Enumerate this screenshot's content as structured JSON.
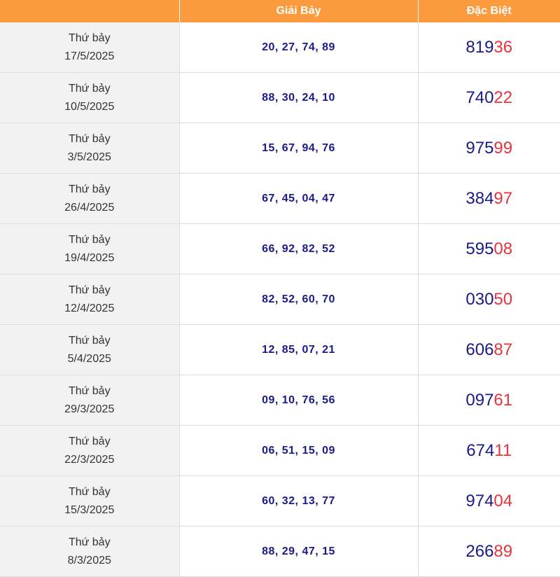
{
  "table": {
    "headers": {
      "date": "",
      "g7": "Giải Bảy",
      "db": "Đặc Biệt"
    },
    "rows": [
      {
        "day": "Thứ bảy",
        "date": "17/5/2025",
        "g7": "20, 27, 74, 89",
        "db_head": "819",
        "db_tail": "36"
      },
      {
        "day": "Thứ bảy",
        "date": "10/5/2025",
        "g7": "88, 30, 24, 10",
        "db_head": "740",
        "db_tail": "22"
      },
      {
        "day": "Thứ bảy",
        "date": "3/5/2025",
        "g7": "15, 67, 94, 76",
        "db_head": "975",
        "db_tail": "99"
      },
      {
        "day": "Thứ bảy",
        "date": "26/4/2025",
        "g7": "67, 45, 04, 47",
        "db_head": "384",
        "db_tail": "97"
      },
      {
        "day": "Thứ bảy",
        "date": "19/4/2025",
        "g7": "66, 92, 82, 52",
        "db_head": "595",
        "db_tail": "08"
      },
      {
        "day": "Thứ bảy",
        "date": "12/4/2025",
        "g7": "82, 52, 60, 70",
        "db_head": "030",
        "db_tail": "50"
      },
      {
        "day": "Thứ bảy",
        "date": "5/4/2025",
        "g7": "12, 85, 07, 21",
        "db_head": "606",
        "db_tail": "87"
      },
      {
        "day": "Thứ bảy",
        "date": "29/3/2025",
        "g7": "09, 10, 76, 56",
        "db_head": "097",
        "db_tail": "61"
      },
      {
        "day": "Thứ bảy",
        "date": "22/3/2025",
        "g7": "06, 51, 15, 09",
        "db_head": "674",
        "db_tail": "11"
      },
      {
        "day": "Thứ bảy",
        "date": "15/3/2025",
        "g7": "60, 32, 13, 77",
        "db_head": "974",
        "db_tail": "04"
      },
      {
        "day": "Thứ bảy",
        "date": "8/3/2025",
        "g7": "88, 29, 47, 15",
        "db_head": "266",
        "db_tail": "89"
      }
    ]
  },
  "colors": {
    "header_bg": "#fb9b3d",
    "number_blue": "#1a1a8a",
    "tail_red": "#e8343c",
    "date_bg": "#f2f2f2"
  }
}
